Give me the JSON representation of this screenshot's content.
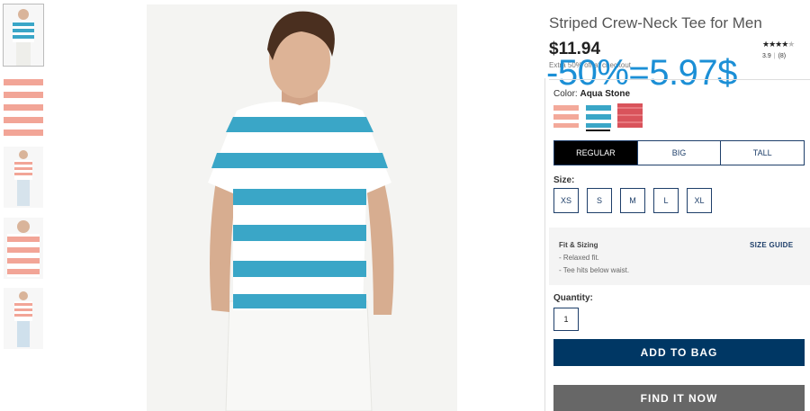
{
  "product": {
    "title": "Striped Crew-Neck Tee for Men",
    "price": "$11.94",
    "extra_text": "Extra 50% off at checkout",
    "promo_overlay": "-50%=5.97$",
    "rating_value": "3.9",
    "review_count": "(8)",
    "stars_filled": "★★★★",
    "stars_empty": "★",
    "rating": 3.9
  },
  "thumbnails": [
    {
      "name": "thumb-aqua-front",
      "stripe": "#3aa6c7",
      "selected": true
    },
    {
      "name": "thumb-coral-closeup",
      "stripe": "#f2a597"
    },
    {
      "name": "thumb-coral-full",
      "stripe": "#f2a597"
    },
    {
      "name": "thumb-coral-detail",
      "stripe": "#f2a597"
    },
    {
      "name": "thumb-coral-full-2",
      "stripe": "#f2a597"
    }
  ],
  "color": {
    "label": "Color:",
    "selected_name": "Aqua Stone",
    "swatches": [
      {
        "name": "coral",
        "color": "#f3a99a"
      },
      {
        "name": "aqua-stone",
        "color": "#3aa6c7",
        "selected": true
      },
      {
        "name": "red",
        "color": "#d9535b"
      }
    ]
  },
  "fit": {
    "tabs": [
      "REGULAR",
      "BIG",
      "TALL"
    ],
    "active": "REGULAR"
  },
  "size": {
    "label": "Size:",
    "options": [
      "XS",
      "S",
      "M",
      "L",
      "XL"
    ]
  },
  "fit_sizing": {
    "title": "Fit & Sizing",
    "size_guide": "SIZE GUIDE",
    "lines": [
      "- Relaxed fit.",
      "- Tee hits below waist."
    ]
  },
  "quantity": {
    "label": "Quantity:",
    "value": "1"
  },
  "buttons": {
    "add_to_bag": "ADD TO BAG",
    "find_it_now": "FIND IT NOW"
  },
  "colors": {
    "primary": "#003764",
    "promo": "#1b8fd6",
    "find_button": "#676767"
  }
}
